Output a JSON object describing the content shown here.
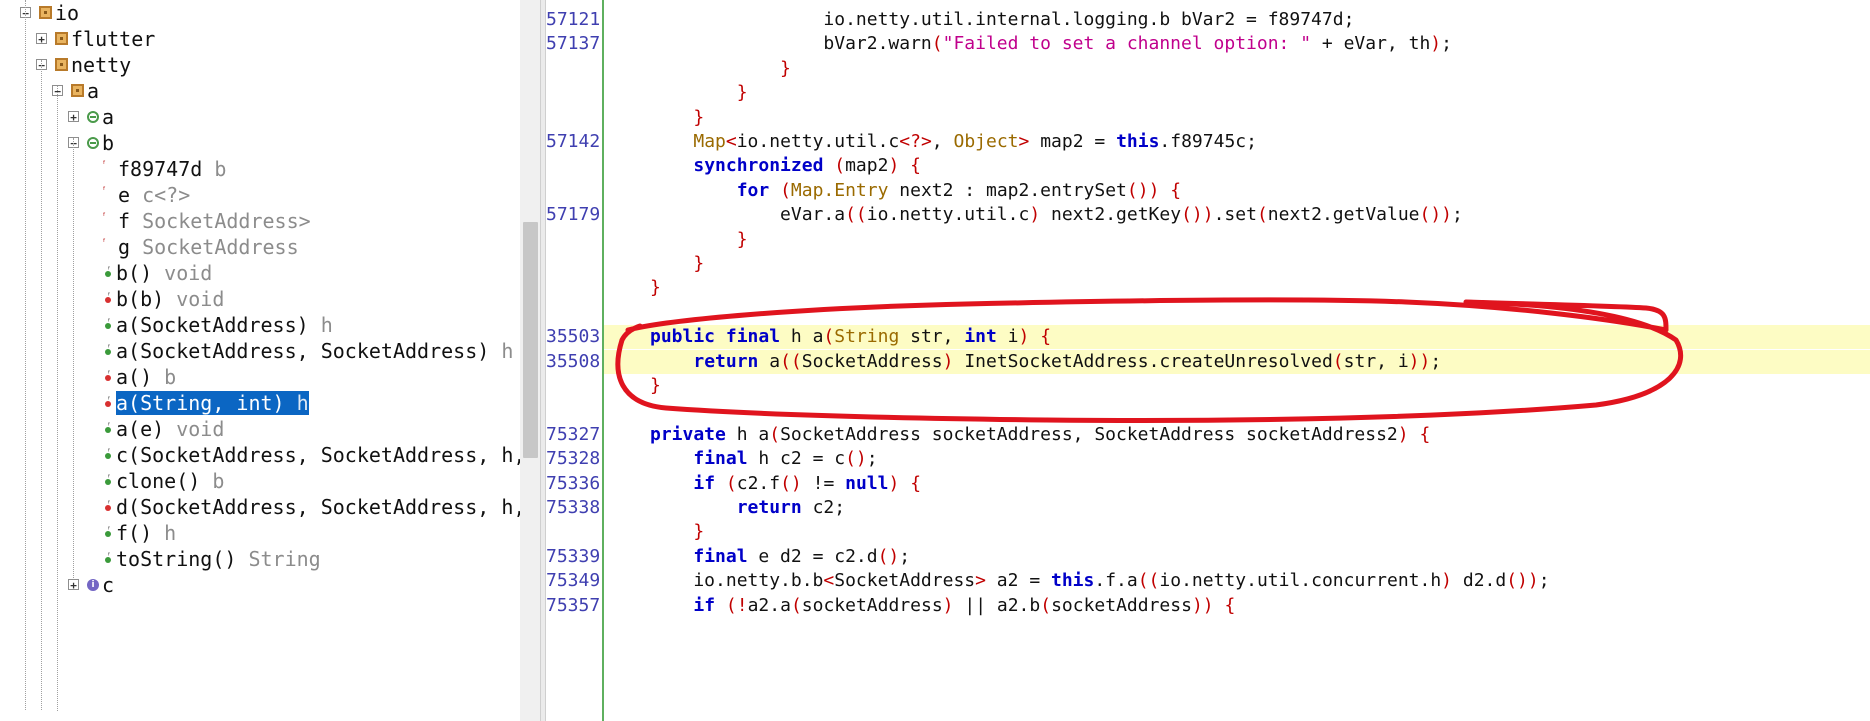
{
  "tree": {
    "nodes": [
      {
        "label": "io",
        "type": "",
        "icon": "package-icon",
        "toggle": "−"
      },
      {
        "label": "flutter",
        "type": "",
        "icon": "package-icon",
        "toggle": "+"
      },
      {
        "label": "netty",
        "type": "",
        "icon": "package-icon",
        "toggle": "−"
      },
      {
        "label": "a",
        "type": "",
        "icon": "package-icon",
        "toggle": "−"
      },
      {
        "label": "a",
        "type": "",
        "icon": "class-icon",
        "toggle": "+"
      },
      {
        "label": "b",
        "type": "",
        "icon": "class-icon",
        "toggle": "−"
      },
      {
        "label": "f89747d",
        "type": "b",
        "icon": "field-icon"
      },
      {
        "label": "e",
        "type": "c<?>",
        "icon": "field-icon"
      },
      {
        "label": "f",
        "type": "SocketAddress>",
        "icon": "field-icon"
      },
      {
        "label": "g",
        "type": "SocketAddress",
        "icon": "field-icon"
      },
      {
        "label": "b()",
        "type": "void",
        "icon": "method-icon"
      },
      {
        "label": "b(b)",
        "type": "void",
        "icon": "method-icon"
      },
      {
        "label": "a(SocketAddress)",
        "type": "h",
        "icon": "method-icon"
      },
      {
        "label": "a(SocketAddress, SocketAddress)",
        "type": "h",
        "icon": "method-icon"
      },
      {
        "label": "a()",
        "type": "b",
        "icon": "method-icon"
      },
      {
        "label": "a(String, int)",
        "type": "h",
        "icon": "method-icon",
        "selected": true
      },
      {
        "label": "a(e)",
        "type": "void",
        "icon": "method-icon"
      },
      {
        "label": "c(SocketAddress, SocketAddress, h,",
        "type": "",
        "icon": "method-icon"
      },
      {
        "label": "clone()",
        "type": "b",
        "icon": "method-icon"
      },
      {
        "label": "d(SocketAddress, SocketAddress, h,",
        "type": "",
        "icon": "method-icon"
      },
      {
        "label": "f()",
        "type": "h",
        "icon": "method-icon"
      },
      {
        "label": "toString()",
        "type": "String",
        "icon": "method-icon"
      },
      {
        "label": "c",
        "type": "",
        "icon": "class-info-icon",
        "toggle": "+"
      }
    ]
  },
  "editor": {
    "highlight_line_index": 13,
    "lines": [
      {
        "num": "57121",
        "tokens": [
          [
            "",
            "                "
          ],
          [
            "",
            "io.netty.util.internal.logging.b bVar2 = f89747d;"
          ]
        ]
      },
      {
        "num": "57137",
        "tokens": [
          [
            "",
            "                bVar2.warn"
          ],
          [
            "p",
            "("
          ],
          [
            "s",
            "\"Failed to set a channel option: \""
          ],
          [
            "",
            " + eVar, th"
          ],
          [
            "p",
            ")"
          ],
          [
            "",
            ";"
          ]
        ]
      },
      {
        "num": "",
        "tokens": [
          [
            "",
            "            "
          ],
          [
            "p",
            "}"
          ]
        ]
      },
      {
        "num": "",
        "tokens": [
          [
            "",
            "        "
          ],
          [
            "p",
            "}"
          ]
        ]
      },
      {
        "num": "",
        "tokens": [
          [
            "",
            "    "
          ],
          [
            "p",
            "}"
          ]
        ]
      },
      {
        "num": "57142",
        "tokens": [
          [
            "",
            "    "
          ],
          [
            "t",
            "Map"
          ],
          [
            "p",
            "<"
          ],
          [
            "",
            "io.netty.util.c"
          ],
          [
            "p",
            "<?>"
          ],
          [
            "",
            ", "
          ],
          [
            "t",
            "Object"
          ],
          [
            "p",
            ">"
          ],
          [
            "",
            " map2 = "
          ],
          [
            "k",
            "this"
          ],
          [
            "",
            ".f89745c;"
          ]
        ]
      },
      {
        "num": "",
        "tokens": [
          [
            "",
            "    "
          ],
          [
            "k",
            "synchronized"
          ],
          [
            "",
            " "
          ],
          [
            "p",
            "("
          ],
          [
            "",
            "map2"
          ],
          [
            "p",
            ")"
          ],
          [
            "",
            " "
          ],
          [
            "p",
            "{"
          ]
        ]
      },
      {
        "num": "",
        "tokens": [
          [
            "",
            "        "
          ],
          [
            "k",
            "for"
          ],
          [
            "",
            " "
          ],
          [
            "p",
            "("
          ],
          [
            "t",
            "Map.Entry"
          ],
          [
            "",
            " next2 : map2.entrySet"
          ],
          [
            "p",
            "()"
          ],
          [
            "p",
            ")"
          ],
          [
            "",
            " "
          ],
          [
            "p",
            "{"
          ]
        ]
      },
      {
        "num": "57179",
        "tokens": [
          [
            "",
            "            eVar.a"
          ],
          [
            "p",
            "(("
          ],
          [
            "",
            "io.netty.util.c"
          ],
          [
            "p",
            ")"
          ],
          [
            "",
            " next2.getKey"
          ],
          [
            "p",
            "())"
          ],
          [
            "",
            ".set"
          ],
          [
            "p",
            "("
          ],
          [
            "",
            "next2.getValue"
          ],
          [
            "p",
            "())"
          ],
          [
            "",
            ";"
          ]
        ]
      },
      {
        "num": "",
        "tokens": [
          [
            "",
            "        "
          ],
          [
            "p",
            "}"
          ]
        ]
      },
      {
        "num": "",
        "tokens": [
          [
            "",
            "    "
          ],
          [
            "p",
            "}"
          ]
        ]
      },
      {
        "num": "",
        "tokens": [
          [
            "p",
            "}"
          ]
        ]
      },
      {
        "num": "",
        "tokens": []
      },
      {
        "num": "35503",
        "tokens": [
          [
            "k",
            "public"
          ],
          [
            "",
            " "
          ],
          [
            "k",
            "final"
          ],
          [
            "",
            " h a"
          ],
          [
            "p",
            "("
          ],
          [
            "t",
            "String"
          ],
          [
            "",
            " str, "
          ],
          [
            "k",
            "int"
          ],
          [
            "",
            " i"
          ],
          [
            "p",
            ")"
          ],
          [
            "",
            " "
          ],
          [
            "p",
            "{"
          ]
        ]
      },
      {
        "num": "35508",
        "tokens": [
          [
            "",
            "    "
          ],
          [
            "k",
            "return"
          ],
          [
            "",
            " a"
          ],
          [
            "p",
            "(("
          ],
          [
            "",
            "SocketAddress"
          ],
          [
            "p",
            ")"
          ],
          [
            "",
            " InetSocketAddress.createUnresolved"
          ],
          [
            "p",
            "("
          ],
          [
            "",
            "str, i"
          ],
          [
            "p",
            "))"
          ],
          [
            "",
            ";"
          ]
        ]
      },
      {
        "num": "",
        "tokens": [
          [
            "p",
            "}"
          ]
        ]
      },
      {
        "num": "",
        "tokens": []
      },
      {
        "num": "75327",
        "tokens": [
          [
            "k",
            "private"
          ],
          [
            "",
            " h a"
          ],
          [
            "p",
            "("
          ],
          [
            "",
            "SocketAddress socketAddress, SocketAddress socketAddress2"
          ],
          [
            "p",
            ")"
          ],
          [
            "",
            " "
          ],
          [
            "p",
            "{"
          ]
        ]
      },
      {
        "num": "75328",
        "tokens": [
          [
            "",
            "    "
          ],
          [
            "k",
            "final"
          ],
          [
            "",
            " h c2 = c"
          ],
          [
            "p",
            "()"
          ],
          [
            "",
            ";"
          ]
        ]
      },
      {
        "num": "75336",
        "tokens": [
          [
            "",
            "    "
          ],
          [
            "k",
            "if"
          ],
          [
            "",
            " "
          ],
          [
            "p",
            "("
          ],
          [
            "",
            "c2.f"
          ],
          [
            "p",
            "()"
          ],
          [
            "",
            " != "
          ],
          [
            "k",
            "null"
          ],
          [
            "p",
            ")"
          ],
          [
            "",
            " "
          ],
          [
            "p",
            "{"
          ]
        ]
      },
      {
        "num": "75338",
        "tokens": [
          [
            "",
            "        "
          ],
          [
            "k",
            "return"
          ],
          [
            "",
            " c2;"
          ]
        ]
      },
      {
        "num": "",
        "tokens": [
          [
            "",
            "    "
          ],
          [
            "p",
            "}"
          ]
        ]
      },
      {
        "num": "75339",
        "tokens": [
          [
            "",
            "    "
          ],
          [
            "k",
            "final"
          ],
          [
            "",
            " e d2 = c2.d"
          ],
          [
            "p",
            "()"
          ],
          [
            "",
            ";"
          ]
        ]
      },
      {
        "num": "75349",
        "tokens": [
          [
            "",
            "    io.netty.b.b"
          ],
          [
            "p",
            "<"
          ],
          [
            "",
            "SocketAddress"
          ],
          [
            "p",
            ">"
          ],
          [
            "",
            " a2 = "
          ],
          [
            "k",
            "this"
          ],
          [
            "",
            ".f.a"
          ],
          [
            "p",
            "(("
          ],
          [
            "",
            "io.netty.util.concurrent.h"
          ],
          [
            "p",
            ")"
          ],
          [
            "",
            " d2.d"
          ],
          [
            "p",
            "())"
          ],
          [
            "",
            ";"
          ]
        ]
      },
      {
        "num": "75357",
        "tokens": [
          [
            "",
            "    "
          ],
          [
            "k",
            "if"
          ],
          [
            "",
            " "
          ],
          [
            "p",
            "(!"
          ],
          [
            "",
            "a2.a"
          ],
          [
            "p",
            "("
          ],
          [
            "",
            "socketAddress"
          ],
          [
            "p",
            ")"
          ],
          [
            "",
            " || a2.b"
          ],
          [
            "p",
            "("
          ],
          [
            "",
            "socketAddress"
          ],
          [
            "p",
            "))"
          ],
          [
            "",
            " "
          ],
          [
            "p",
            "{"
          ]
        ]
      }
    ]
  },
  "colors": {
    "keyword": "#0000c8",
    "type": "#9a6a00",
    "string": "#c0008c",
    "punct": "#c00000",
    "selection": "#0b66c3",
    "annotation": "#e0141e"
  }
}
